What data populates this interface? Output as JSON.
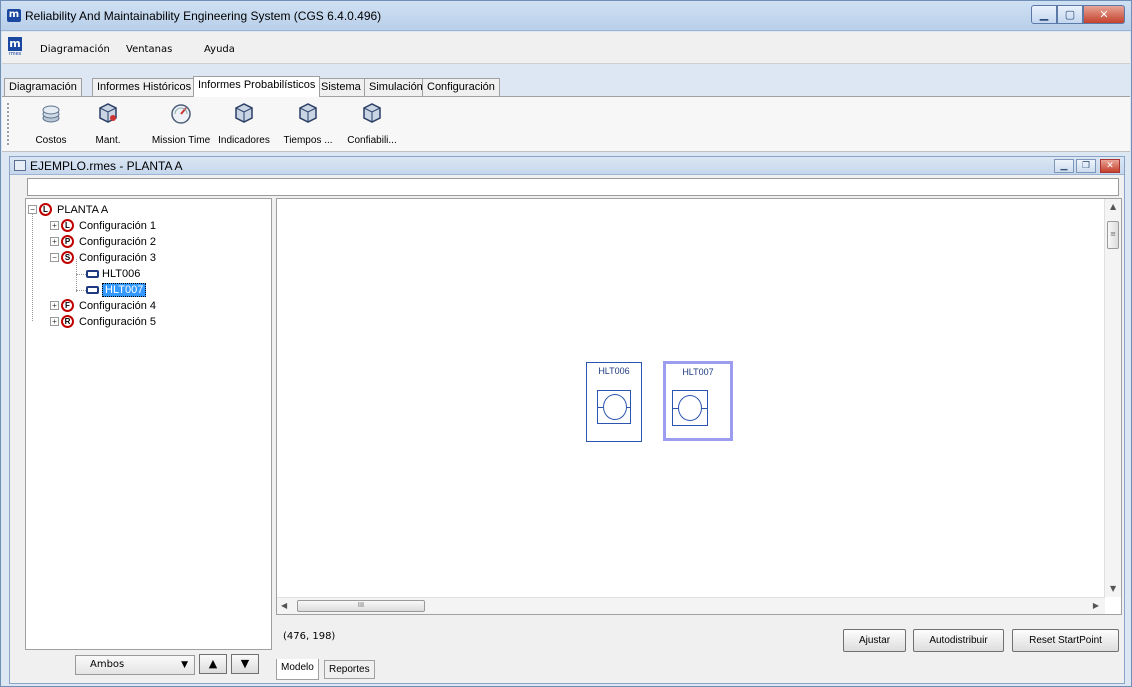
{
  "window": {
    "title": "Reliability And Maintainability Engineering System (CGS 6.4.0.496)",
    "icon_letter": "m"
  },
  "menu": {
    "logo_letter": "m",
    "logo_sub": "rmes",
    "items": [
      "Diagramación",
      "Ventanas",
      "Ayuda"
    ]
  },
  "tabs": [
    {
      "label": "Diagramación",
      "active": false
    },
    {
      "label": "Informes Históricos",
      "active": false
    },
    {
      "label": "Informes Probabilísticos",
      "active": true
    },
    {
      "label": "Sistema",
      "active": false
    },
    {
      "label": "Simulación",
      "active": false
    },
    {
      "label": "Configuración",
      "active": false
    }
  ],
  "toolbar": {
    "items": [
      {
        "label": "Costos",
        "icon": "coins-icon"
      },
      {
        "label": "Mant.",
        "icon": "maintenance-cube-icon"
      },
      {
        "label": "Mission Time",
        "icon": "gauge-icon"
      },
      {
        "label": "Indicadores",
        "icon": "cube-icon"
      },
      {
        "label": "Tiempos ...",
        "icon": "cube-icon"
      },
      {
        "label": "Confiabili...",
        "icon": "cube-icon"
      }
    ]
  },
  "document": {
    "title": "EJEMPLO.rmes - PLANTA A"
  },
  "tree": {
    "root": {
      "label": "PLANTA A",
      "badge": "L"
    },
    "items": [
      {
        "label": "Configuración 1",
        "badge": "L",
        "expanded": false
      },
      {
        "label": "Configuración 2",
        "badge": "P",
        "expanded": false
      },
      {
        "label": "Configuración 3",
        "badge": "S",
        "expanded": true
      },
      {
        "label": "HLT006",
        "type": "component",
        "selected": false
      },
      {
        "label": "HLT007",
        "type": "component",
        "selected": true
      },
      {
        "label": "Configuración 4",
        "badge": "F",
        "expanded": false
      },
      {
        "label": "Configuración 5",
        "badge": "R",
        "expanded": false
      }
    ]
  },
  "filter": {
    "selected": "Ambos"
  },
  "canvas": {
    "blocks": [
      {
        "label": "HLT006",
        "selected": false
      },
      {
        "label": "HLT007",
        "selected": true
      }
    ],
    "coords": "(476, 198)",
    "scroll_mark": "III"
  },
  "actions": {
    "ajustar": "Ajustar",
    "autodistribuir": "Autodistribuir",
    "reset": "Reset StartPoint"
  },
  "bottom_tabs": [
    {
      "label": "Modelo",
      "active": true
    },
    {
      "label": "Reportes",
      "active": false
    }
  ],
  "colors": {
    "title_gradient_top": "#cfe0f3",
    "selection": "#3399ff",
    "badge_ring": "#c00000",
    "block_border": "#2b54b0",
    "block_selected": "#9c9cf0"
  }
}
